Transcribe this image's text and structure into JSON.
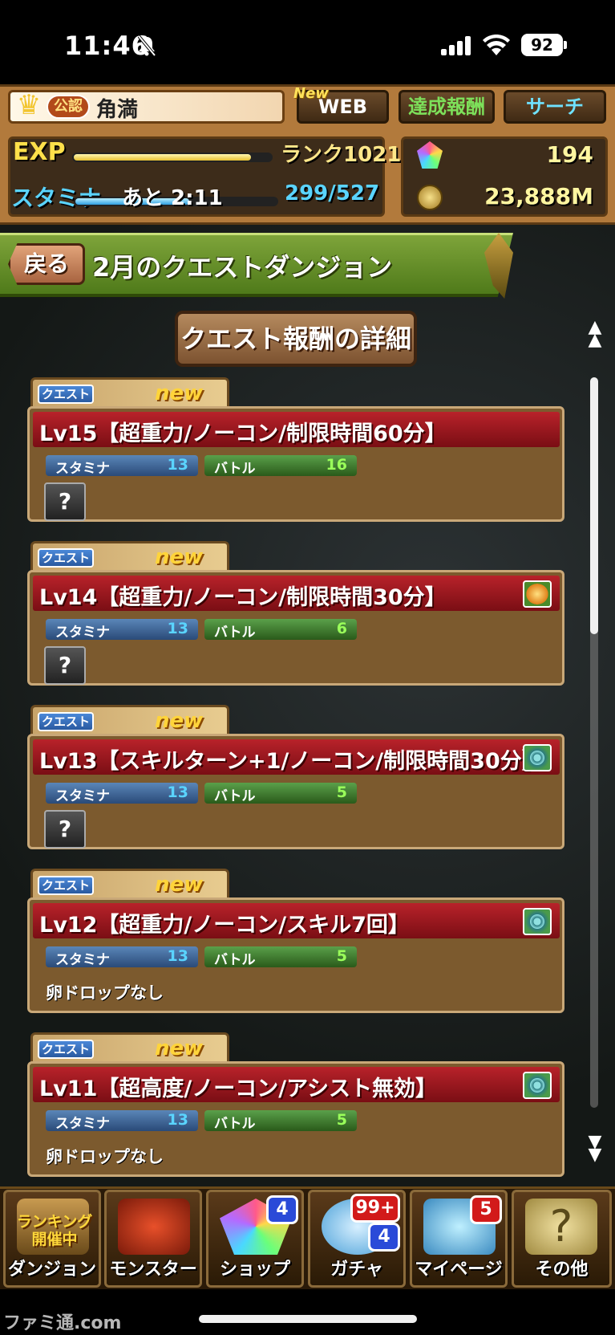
{
  "status_bar": {
    "time": "11:46",
    "battery": "92"
  },
  "header": {
    "official_badge": "公認",
    "player_name": "角満",
    "new_tag": "New",
    "web_button": "WEB",
    "reward_button": "達成報酬",
    "search_button": "サーチ",
    "exp_label": "EXP",
    "exp_progress": 0.9,
    "rank": "ランク1021",
    "stamina_label": "スタミナ",
    "stamina_timer": "あと 2:11",
    "stamina_value": "299/527",
    "stamina_progress": 0.567,
    "magic_stones": "194",
    "coins": "23,888M"
  },
  "page": {
    "back_button": "戻る",
    "title": "2月のクエストダンジョン",
    "detail_button": "クエスト報酬の詳細"
  },
  "quests": [
    {
      "tab": "クエスト",
      "new": "new",
      "title": "Lv15【超重力/ノーコン/制限時間60分】",
      "stamina_label": "スタミナ",
      "stamina": "13",
      "battle_label": "バトル",
      "battles": "16",
      "badge": "",
      "drop": "?"
    },
    {
      "tab": "クエスト",
      "new": "new",
      "title": "Lv14【超重力/ノーコン/制限時間30分】",
      "stamina_label": "スタミナ",
      "stamina": "13",
      "battle_label": "バトル",
      "battles": "6",
      "badge": "fire",
      "drop": "?"
    },
    {
      "tab": "クエスト",
      "new": "new",
      "title": "Lv13【スキルターン+1/ノーコン/制限時間30分】",
      "stamina_label": "スタミナ",
      "stamina": "13",
      "battle_label": "バトル",
      "battles": "5",
      "badge": "swirl",
      "drop": "?"
    },
    {
      "tab": "クエスト",
      "new": "new",
      "title": "Lv12【超重力/ノーコン/スキル7回】",
      "stamina_label": "スタミナ",
      "stamina": "13",
      "battle_label": "バトル",
      "battles": "5",
      "badge": "swirl",
      "drop_text": "卵ドロップなし"
    },
    {
      "tab": "クエスト",
      "new": "new",
      "title": "Lv11【超高度/ノーコン/アシスト無効】",
      "stamina_label": "スタミナ",
      "stamina": "13",
      "battle_label": "バトル",
      "battles": "5",
      "badge": "swirl",
      "drop_text": "卵ドロップなし"
    }
  ],
  "nav": {
    "ranking_tag": "ランキング開催中",
    "dungeon": "ダンジョン",
    "monster": "モンスター",
    "shop": "ショップ",
    "shop_badge": "4",
    "gacha": "ガチャ",
    "gacha_badge_top": "99+",
    "gacha_badge": "4",
    "mypage": "マイページ",
    "mypage_badge": "5",
    "other": "その他"
  },
  "watermark": "ファミ通.com",
  "icons": {
    "bell": "bell-slash-icon",
    "signal": "signal-icon",
    "wifi": "wifi-icon",
    "stone": "magic-stone-icon",
    "coin": "coin-icon"
  }
}
